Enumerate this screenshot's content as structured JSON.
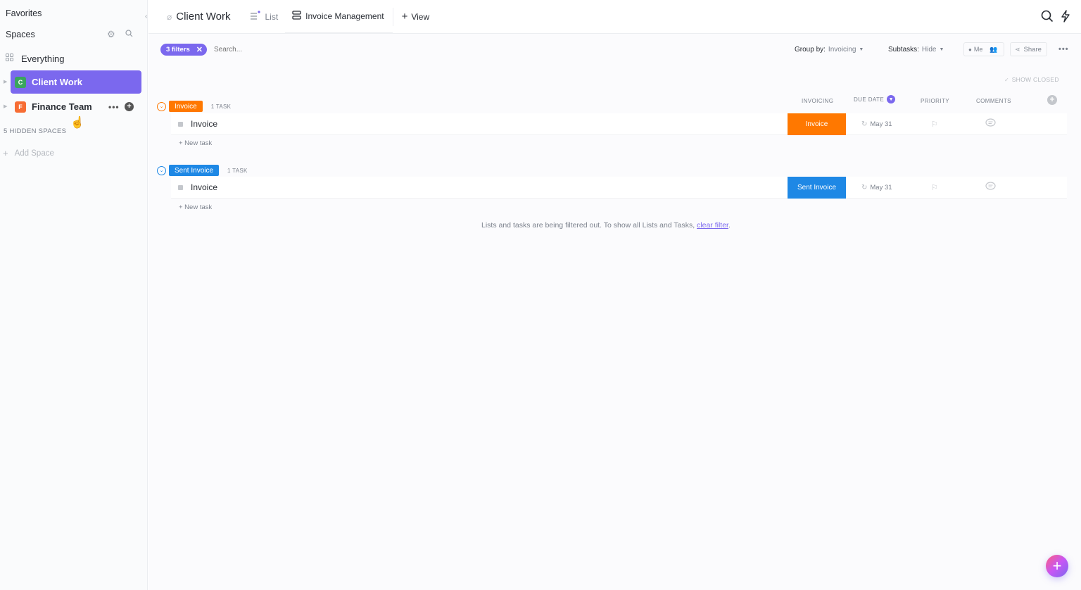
{
  "sidebar": {
    "favorites_label": "Favorites",
    "spaces_label": "Spaces",
    "everything_label": "Everything",
    "spaces": [
      {
        "initial": "C",
        "label": "Client Work",
        "color": "#3aa55d",
        "active": true
      },
      {
        "initial": "F",
        "label": "Finance Team",
        "color": "#f76d34",
        "active": false
      }
    ],
    "hidden_spaces_label": "5 HIDDEN SPACES",
    "add_space_label": "Add Space"
  },
  "header": {
    "space_title": "Client Work",
    "tabs": [
      {
        "label": "List"
      },
      {
        "label": "Invoice Management"
      }
    ],
    "add_view_label": "View"
  },
  "toolbar": {
    "filters_label": "3 filters",
    "search_placeholder": "Search...",
    "group_by_label": "Group by:",
    "group_by_value": "Invoicing",
    "subtasks_label": "Subtasks:",
    "subtasks_value": "Hide",
    "me_label": "Me",
    "share_label": "Share",
    "show_closed_label": "SHOW CLOSED"
  },
  "columns": {
    "invoicing": "INVOICING",
    "due_date": "DUE DATE",
    "priority": "PRIORITY",
    "comments": "COMMENTS"
  },
  "groups": [
    {
      "status": "Invoice",
      "color": "#ff7800",
      "count_label": "1 TASK",
      "tasks": [
        {
          "name": "Invoice",
          "status": "Invoice",
          "due": "May 31"
        }
      ],
      "new_task_label": "+ New task"
    },
    {
      "status": "Sent Invoice",
      "color": "#1e88e5",
      "count_label": "1 TASK",
      "tasks": [
        {
          "name": "Invoice",
          "status": "Sent Invoice",
          "due": "May 31"
        }
      ],
      "new_task_label": "+ New task"
    }
  ],
  "notice": {
    "text": "Lists and tasks are being filtered out. To show all Lists and Tasks,",
    "link": "clear filter",
    "end": "."
  },
  "colors": {
    "accent": "#7b68ee",
    "invoice": "#ff7800",
    "sent_invoice": "#1e88e5"
  }
}
